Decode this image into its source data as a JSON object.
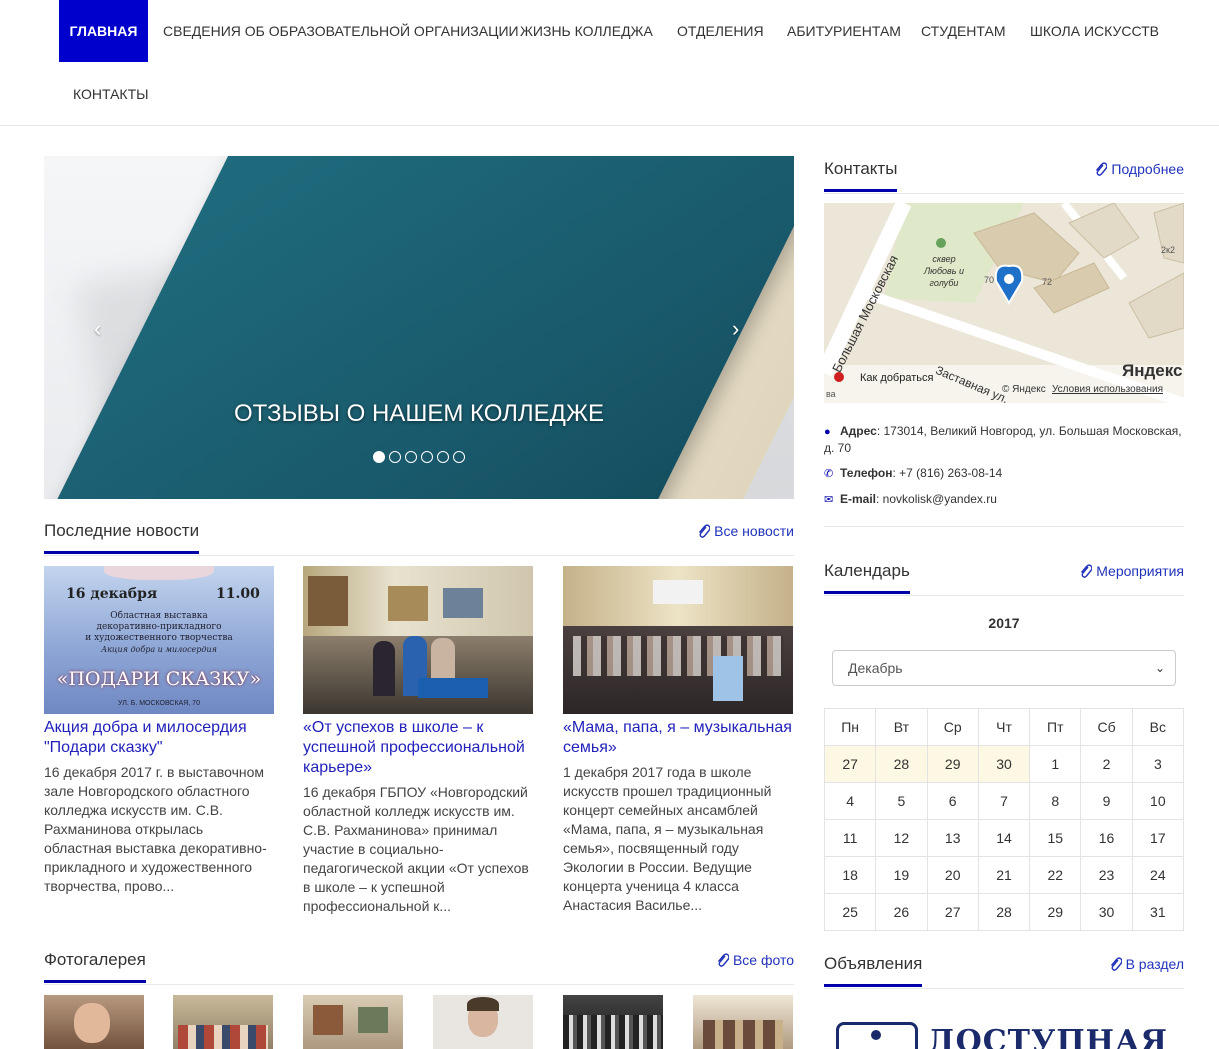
{
  "nav": {
    "items": [
      {
        "label": "Главная",
        "active": true
      },
      {
        "label": "Сведения об образовательной организации"
      },
      {
        "label": "Жизнь колледжа"
      },
      {
        "label": "Отделения"
      },
      {
        "label": "Абитуриентам"
      },
      {
        "label": "Студентам"
      },
      {
        "label": "Школа искусств"
      },
      {
        "label": "Контакты"
      }
    ]
  },
  "slider": {
    "caption": "ОТЗЫВЫ О НАШЕМ КОЛЛЕДЖЕ",
    "prev_icon": "chevron-left-icon",
    "next_icon": "chevron-right-icon",
    "slide_count": 6,
    "active_slide": 1
  },
  "news": {
    "title": "Последние новости",
    "all_link": "Все новости",
    "items": [
      {
        "title": "Акция добра и милосердия \"Подари сказку\"",
        "text": "16 декабря 2017 г. в выставочном зале Новгородского областного колледжа искусств им. С.В. Рахманинова открылась областная выставка декоративно-прикладного и художественного творчества, прово...",
        "poster_date": "16 декабря",
        "poster_time": "11.00",
        "poster_line1": "Областная выставка",
        "poster_line2": "декоративно-прикладного",
        "poster_line3": "и художественного творчества",
        "poster_line4": "Акция добра и милосердия",
        "poster_title": "«ПОДАРИ СКАЗКУ»",
        "poster_address": "УЛ. Б. МОСКОВСКАЯ, 70"
      },
      {
        "title": "«От успехов в школе – к успешной профессиональной карьере»",
        "text": "16 декабря ГБПОУ «Новгородский областной колледж искусств им. С.В. Рахманинова» принимал участие в социально-педагогической акции «От успехов в школе – к успешной профессиональной к..."
      },
      {
        "title": "«Мама, папа, я – музыкальная семья»",
        "text": "1 декабря 2017 года в школе искусств прошел традиционный концерт семейных ансамблей «Мама, папа, я – музыкальная семья», посвященный году Экологии в России. Ведущие концерта ученица 4 класса Анастасия Василье..."
      }
    ]
  },
  "gallery": {
    "title": "Фотогалерея",
    "all_link": "Все фото"
  },
  "contacts": {
    "title": "Контакты",
    "more_link": "Подробнее",
    "map": {
      "street_main": "Большая Московская",
      "street_side": "Заставная ул.",
      "park": "сквер Любовь и голуби",
      "bld_70": "70",
      "bld_72": "72",
      "bld_2k2": "2к2",
      "edge_label": "ва",
      "brand": "Яндекс",
      "route": "Как добраться",
      "copyright": "© Яндекс",
      "terms": "Условия использования"
    },
    "address_label": "Адрес",
    "address": ": 173014, Великий Новгород, ул. Большая Московская, д. 70",
    "phone_label": "Телефон",
    "phone": ": +7 (816) 263-08-14",
    "email_label": "E-mail",
    "email": ": novkolisk@yandex.ru"
  },
  "calendar": {
    "title": "Календарь",
    "events_link": "Мероприятия",
    "year": "2017",
    "month": "Декабрь",
    "weekdays": [
      "Пн",
      "Вт",
      "Ср",
      "Чт",
      "Пт",
      "Сб",
      "Вс"
    ],
    "weeks": [
      [
        "27",
        "28",
        "29",
        "30",
        "1",
        "2",
        "3"
      ],
      [
        "4",
        "5",
        "6",
        "7",
        "8",
        "9",
        "10"
      ],
      [
        "11",
        "12",
        "13",
        "14",
        "15",
        "16",
        "17"
      ],
      [
        "18",
        "19",
        "20",
        "21",
        "22",
        "23",
        "24"
      ],
      [
        "25",
        "26",
        "27",
        "28",
        "29",
        "30",
        "31"
      ]
    ],
    "prev_month_days_in_first_week": 4
  },
  "announcements": {
    "title": "Объявления",
    "section_link": "В раздел",
    "banner_text": "ДОСТУПНАЯ"
  },
  "colors": {
    "accent": "#0000cc",
    "link": "#2233bb",
    "prev_day_bg": "#fcf8e3"
  }
}
